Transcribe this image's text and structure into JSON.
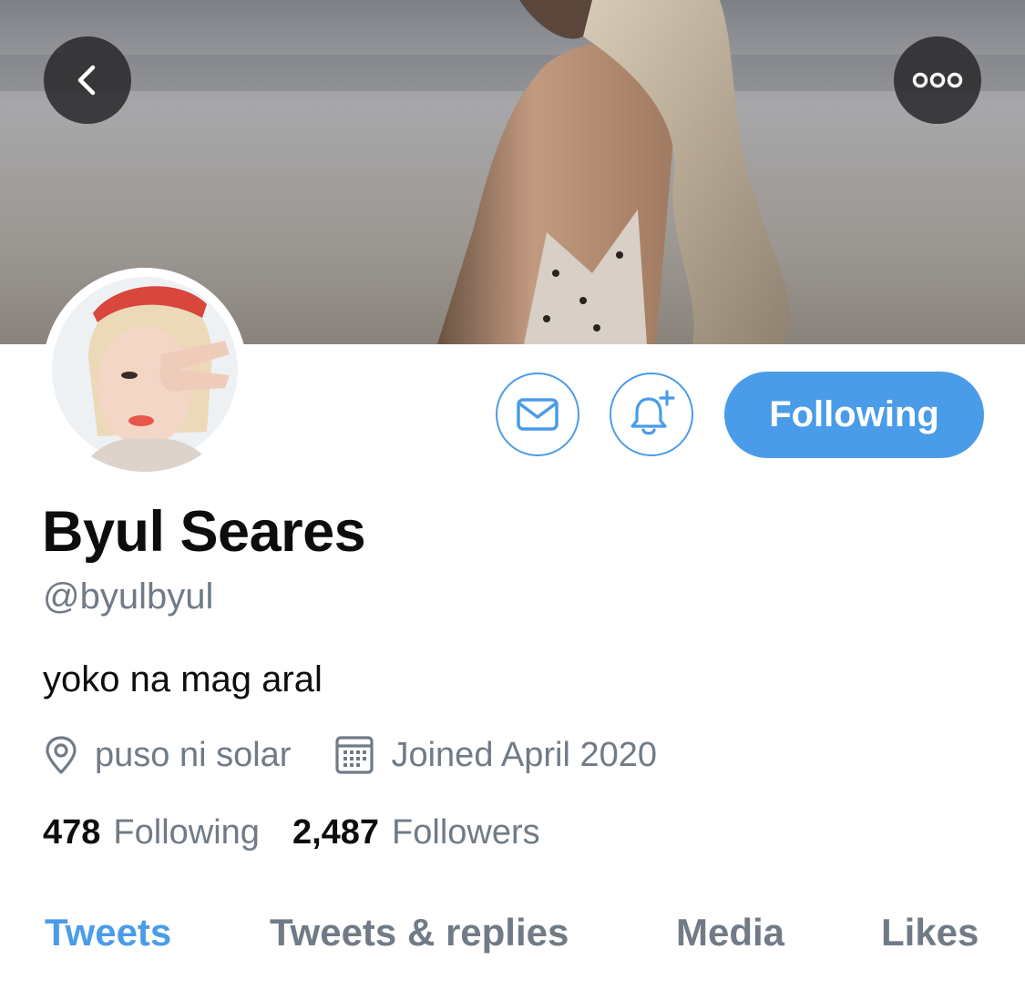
{
  "header": {
    "back_icon": "chevron-left-icon",
    "more_icon": "more-dots-icon"
  },
  "actions": {
    "message_icon": "envelope-icon",
    "notify_icon": "bell-plus-icon",
    "follow_label": "Following"
  },
  "colors": {
    "accent": "#4a9ce8",
    "muted": "#707b87",
    "text": "#0d0d0d"
  },
  "profile": {
    "display_name": "Byul Seares",
    "handle": "@byulbyul",
    "bio": "yoko na mag aral",
    "location": "puso ni solar",
    "joined": "Joined April 2020",
    "following_count": "478",
    "following_label": "Following",
    "followers_count": "2,487",
    "followers_label": "Followers"
  },
  "tabs": [
    {
      "label": "Tweets",
      "active": true
    },
    {
      "label": "Tweets & replies",
      "active": false
    },
    {
      "label": "Media",
      "active": false
    },
    {
      "label": "Likes",
      "active": false
    }
  ]
}
